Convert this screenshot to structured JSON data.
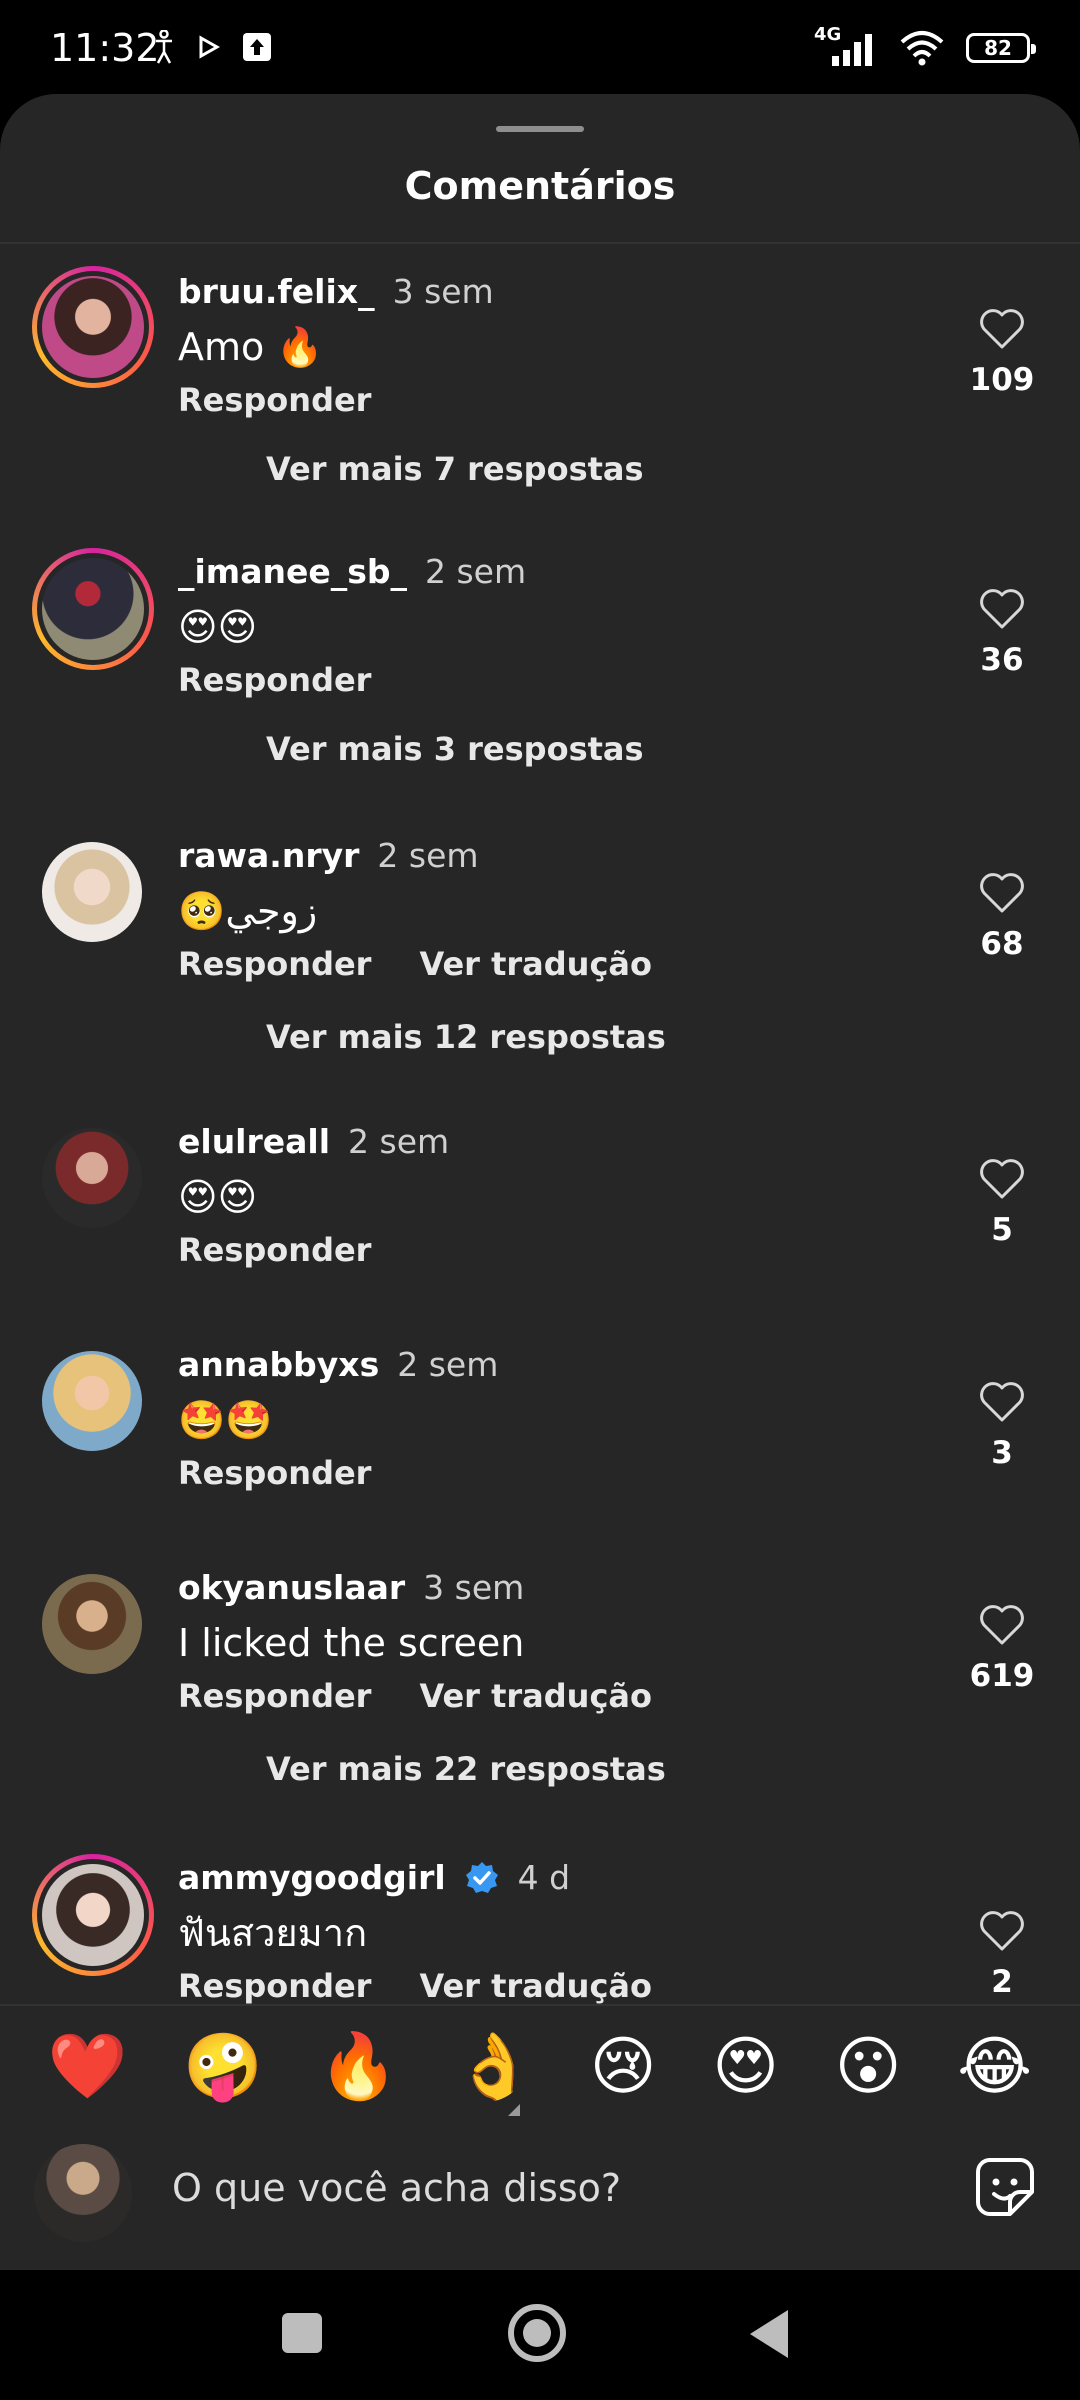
{
  "status_bar": {
    "time": "11:32",
    "network": "4G",
    "battery": "82"
  },
  "sheet": {
    "title": "Comentários"
  },
  "comments": [
    {
      "user": "bruu.felix_",
      "time": "3 sem",
      "text": "Amo 🔥",
      "reply": "Responder",
      "translate": "",
      "more": "Ver mais 7 respostas",
      "likes": "109"
    },
    {
      "user": "_imanee_sb_",
      "time": "2 sem",
      "text": "😍😍",
      "reply": "Responder",
      "translate": "",
      "more": "Ver mais 3 respostas",
      "likes": "36"
    },
    {
      "user": "rawa.nryr",
      "time": "2 sem",
      "text": "🥺زوجي",
      "reply": "Responder",
      "translate": "Ver tradução",
      "more": "Ver mais 12 respostas",
      "likes": "68"
    },
    {
      "user": "elulreall",
      "time": "2 sem",
      "text": "😍😍",
      "reply": "Responder",
      "translate": "",
      "more": "",
      "likes": "5"
    },
    {
      "user": "annabbyxs",
      "time": "2 sem",
      "text": "🤩🤩",
      "reply": "Responder",
      "translate": "",
      "more": "",
      "likes": "3"
    },
    {
      "user": "okyanuslaar",
      "time": "3 sem",
      "text": "I licked the screen",
      "reply": "Responder",
      "translate": "Ver tradução",
      "more": "Ver mais 22 respostas",
      "likes": "619"
    },
    {
      "user": "ammygoodgirl",
      "time": "4 d",
      "text": "ฟันสวยมาก",
      "reply": "Responder",
      "translate": "Ver tradução",
      "more": "",
      "likes": "2",
      "verified": true
    }
  ],
  "reactions": [
    "❤️",
    "🤪",
    "🔥",
    "👌",
    "😢",
    "😍",
    "😮",
    "😂"
  ],
  "composer": {
    "placeholder": "O que você acha disso?"
  },
  "icons": {
    "like": "heart-outline-icon",
    "sticker": "sticker-icon",
    "verified": "verified-badge-icon"
  },
  "colors": {
    "sheet_bg": "#262626",
    "verified": "#3897f0"
  }
}
